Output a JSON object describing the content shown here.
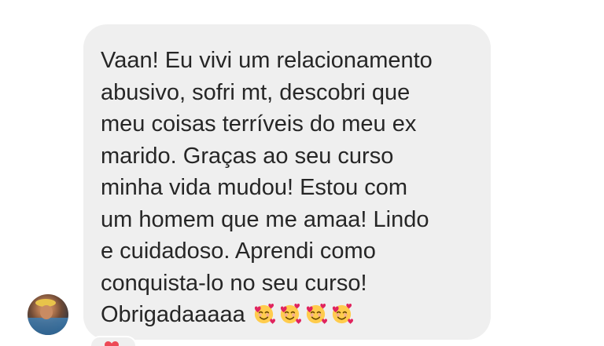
{
  "message": {
    "lines": [
      "Vaan! Eu vivi um relacionamento",
      "abusivo, sofri mt, descobri que",
      "meu coisas terríveis do meu ex",
      "marido. Graças ao seu curso",
      "minha vida mudou! Estou com",
      "um homem que me amaa! Lindo",
      "e cuidadoso. Aprendi como",
      "conquista-lo no seu curso!",
      "Obrigadaaaaa"
    ],
    "emojis": [
      "smiling-face-with-hearts",
      "smiling-face-with-hearts",
      "smiling-face-with-hearts",
      "smiling-face-with-hearts"
    ]
  },
  "colors": {
    "bubble_background": "#efefef",
    "text": "#262626",
    "reaction_heart": "#ed4956"
  },
  "sender": {
    "avatar_icon": "profile-photo"
  },
  "reaction": {
    "icon": "heart-icon"
  }
}
